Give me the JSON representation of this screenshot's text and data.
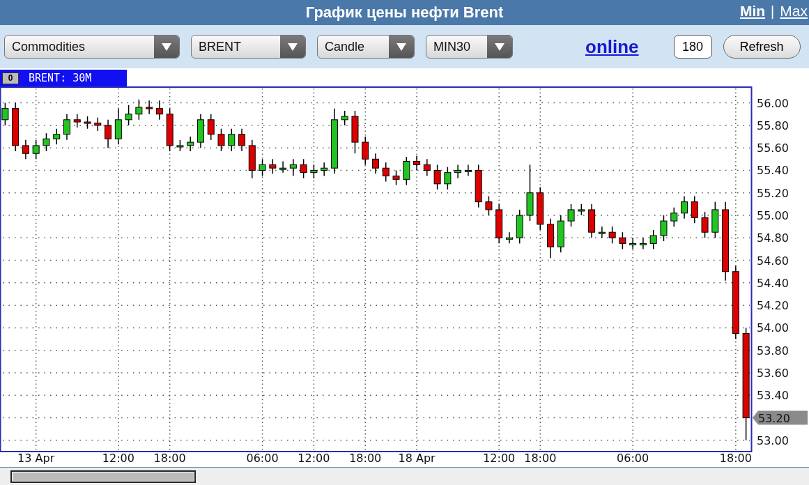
{
  "header": {
    "title": "График цены нефти Brent",
    "links": [
      {
        "label": "Min",
        "selected": true
      },
      {
        "label": "Max",
        "selected": false
      }
    ],
    "separator": "|"
  },
  "toolbar": {
    "selects": [
      {
        "value": "Commodities"
      },
      {
        "value": "BRENT"
      },
      {
        "value": "Candle"
      },
      {
        "value": "MIN30"
      }
    ],
    "link": "online",
    "input_value": "180",
    "button": "Refresh"
  },
  "chart": {
    "panel_button": "0",
    "price_marker": "53.20",
    "chart_data": {
      "type": "candlestick",
      "title": "BRENT: 30M",
      "grid": true,
      "ylim": [
        52.9,
        56.14
      ],
      "yticks": [
        {
          "value": 53.0,
          "label": "53.00"
        },
        {
          "value": 53.4,
          "label": "53.40"
        },
        {
          "value": 53.6,
          "label": "53.60"
        },
        {
          "value": 53.8,
          "label": "53.80"
        },
        {
          "value": 54.0,
          "label": "54.00"
        },
        {
          "value": 54.2,
          "label": "54.20"
        },
        {
          "value": 54.4,
          "label": "54.40"
        },
        {
          "value": 54.6,
          "label": "54.60"
        },
        {
          "value": 54.8,
          "label": "54.80"
        },
        {
          "value": 55.0,
          "label": "55.00"
        },
        {
          "value": 55.2,
          "label": "55.20"
        },
        {
          "value": 55.4,
          "label": "55.40"
        },
        {
          "value": 55.6,
          "label": "55.60"
        },
        {
          "value": 55.8,
          "label": "55.80"
        },
        {
          "value": 56.0,
          "label": "56.00"
        }
      ],
      "categories": [
        null,
        null,
        null,
        "13 Apr",
        null,
        null,
        null,
        null,
        null,
        null,
        null,
        "12:00",
        null,
        null,
        null,
        null,
        "18:00",
        null,
        null,
        null,
        null,
        null,
        null,
        null,
        null,
        "06:00",
        null,
        null,
        null,
        null,
        "12:00",
        null,
        null,
        null,
        null,
        "18:00",
        null,
        null,
        null,
        null,
        "18 Apr",
        null,
        null,
        null,
        null,
        null,
        null,
        null,
        "12:00",
        null,
        null,
        null,
        "18:00",
        null,
        null,
        null,
        null,
        null,
        null,
        null,
        null,
        "06:00",
        null,
        null,
        null,
        null,
        null,
        null,
        null,
        null,
        null,
        "18:00",
        null
      ],
      "ohlc": [
        [
          55.85,
          56.0,
          55.8,
          55.95
        ],
        [
          55.95,
          56.0,
          55.57,
          55.62
        ],
        [
          55.62,
          55.67,
          55.5,
          55.55
        ],
        [
          55.55,
          55.67,
          55.5,
          55.62
        ],
        [
          55.62,
          55.73,
          55.57,
          55.68
        ],
        [
          55.68,
          55.77,
          55.63,
          55.72
        ],
        [
          55.72,
          55.9,
          55.67,
          55.85
        ],
        [
          55.85,
          55.9,
          55.78,
          55.83
        ],
        [
          55.83,
          55.88,
          55.77,
          55.82
        ],
        [
          55.82,
          55.87,
          55.75,
          55.8
        ],
        [
          55.8,
          55.85,
          55.6,
          55.68
        ],
        [
          55.68,
          55.95,
          55.63,
          55.85
        ],
        [
          55.85,
          55.98,
          55.8,
          55.9
        ],
        [
          55.9,
          56.03,
          55.85,
          55.96
        ],
        [
          55.96,
          56.02,
          55.9,
          55.95
        ],
        [
          55.95,
          56.02,
          55.85,
          55.9
        ],
        [
          55.9,
          55.95,
          55.57,
          55.62
        ],
        [
          55.62,
          55.67,
          55.57,
          55.62
        ],
        [
          55.62,
          55.7,
          55.57,
          55.65
        ],
        [
          55.65,
          55.9,
          55.6,
          55.85
        ],
        [
          55.85,
          55.9,
          55.67,
          55.72
        ],
        [
          55.72,
          55.77,
          55.57,
          55.62
        ],
        [
          55.62,
          55.77,
          55.57,
          55.72
        ],
        [
          55.72,
          55.77,
          55.57,
          55.62
        ],
        [
          55.62,
          55.67,
          55.33,
          55.4
        ],
        [
          55.4,
          55.5,
          55.35,
          55.45
        ],
        [
          55.45,
          55.5,
          55.37,
          55.42
        ],
        [
          55.42,
          55.48,
          55.38,
          55.42
        ],
        [
          55.42,
          55.5,
          55.35,
          55.45
        ],
        [
          55.45,
          55.5,
          55.33,
          55.38
        ],
        [
          55.38,
          55.45,
          55.33,
          55.4
        ],
        [
          55.4,
          55.47,
          55.35,
          55.42
        ],
        [
          55.42,
          55.95,
          55.37,
          55.85
        ],
        [
          55.85,
          55.93,
          55.8,
          55.88
        ],
        [
          55.88,
          55.93,
          55.55,
          55.65
        ],
        [
          55.65,
          55.7,
          55.45,
          55.5
        ],
        [
          55.5,
          55.55,
          55.37,
          55.42
        ],
        [
          55.42,
          55.47,
          55.3,
          55.35
        ],
        [
          55.35,
          55.4,
          55.27,
          55.32
        ],
        [
          55.32,
          55.52,
          55.27,
          55.48
        ],
        [
          55.48,
          55.53,
          55.4,
          55.45
        ],
        [
          55.45,
          55.5,
          55.35,
          55.4
        ],
        [
          55.4,
          55.45,
          55.23,
          55.28
        ],
        [
          55.28,
          55.43,
          55.23,
          55.38
        ],
        [
          55.38,
          55.45,
          55.33,
          55.4
        ],
        [
          55.4,
          55.45,
          55.35,
          55.4
        ],
        [
          55.4,
          55.45,
          55.07,
          55.12
        ],
        [
          55.12,
          55.17,
          55.0,
          55.05
        ],
        [
          55.05,
          55.1,
          54.75,
          54.8
        ],
        [
          54.8,
          54.85,
          54.75,
          54.8
        ],
        [
          54.8,
          55.05,
          54.75,
          55.0
        ],
        [
          55.0,
          55.45,
          54.95,
          55.2
        ],
        [
          55.2,
          55.25,
          54.87,
          54.92
        ],
        [
          54.92,
          54.97,
          54.62,
          54.72
        ],
        [
          54.72,
          55.0,
          54.67,
          54.95
        ],
        [
          54.95,
          55.1,
          54.9,
          55.05
        ],
        [
          55.05,
          55.1,
          55.0,
          55.05
        ],
        [
          55.05,
          55.1,
          54.8,
          54.85
        ],
        [
          54.85,
          54.9,
          54.8,
          54.85
        ],
        [
          54.85,
          54.9,
          54.75,
          54.8
        ],
        [
          54.8,
          54.85,
          54.7,
          54.75
        ],
        [
          54.75,
          54.8,
          54.7,
          54.75
        ],
        [
          54.75,
          54.8,
          54.7,
          54.75
        ],
        [
          54.75,
          54.87,
          54.7,
          54.82
        ],
        [
          54.82,
          55.0,
          54.77,
          54.95
        ],
        [
          54.95,
          55.07,
          54.9,
          55.02
        ],
        [
          55.02,
          55.17,
          54.97,
          55.12
        ],
        [
          55.12,
          55.17,
          54.93,
          54.98
        ],
        [
          54.98,
          55.03,
          54.8,
          54.85
        ],
        [
          54.85,
          55.12,
          54.8,
          55.05
        ],
        [
          55.05,
          55.12,
          54.42,
          54.5
        ],
        [
          54.5,
          54.55,
          53.9,
          53.95
        ],
        [
          53.95,
          54.0,
          53.0,
          53.2
        ]
      ]
    }
  }
}
